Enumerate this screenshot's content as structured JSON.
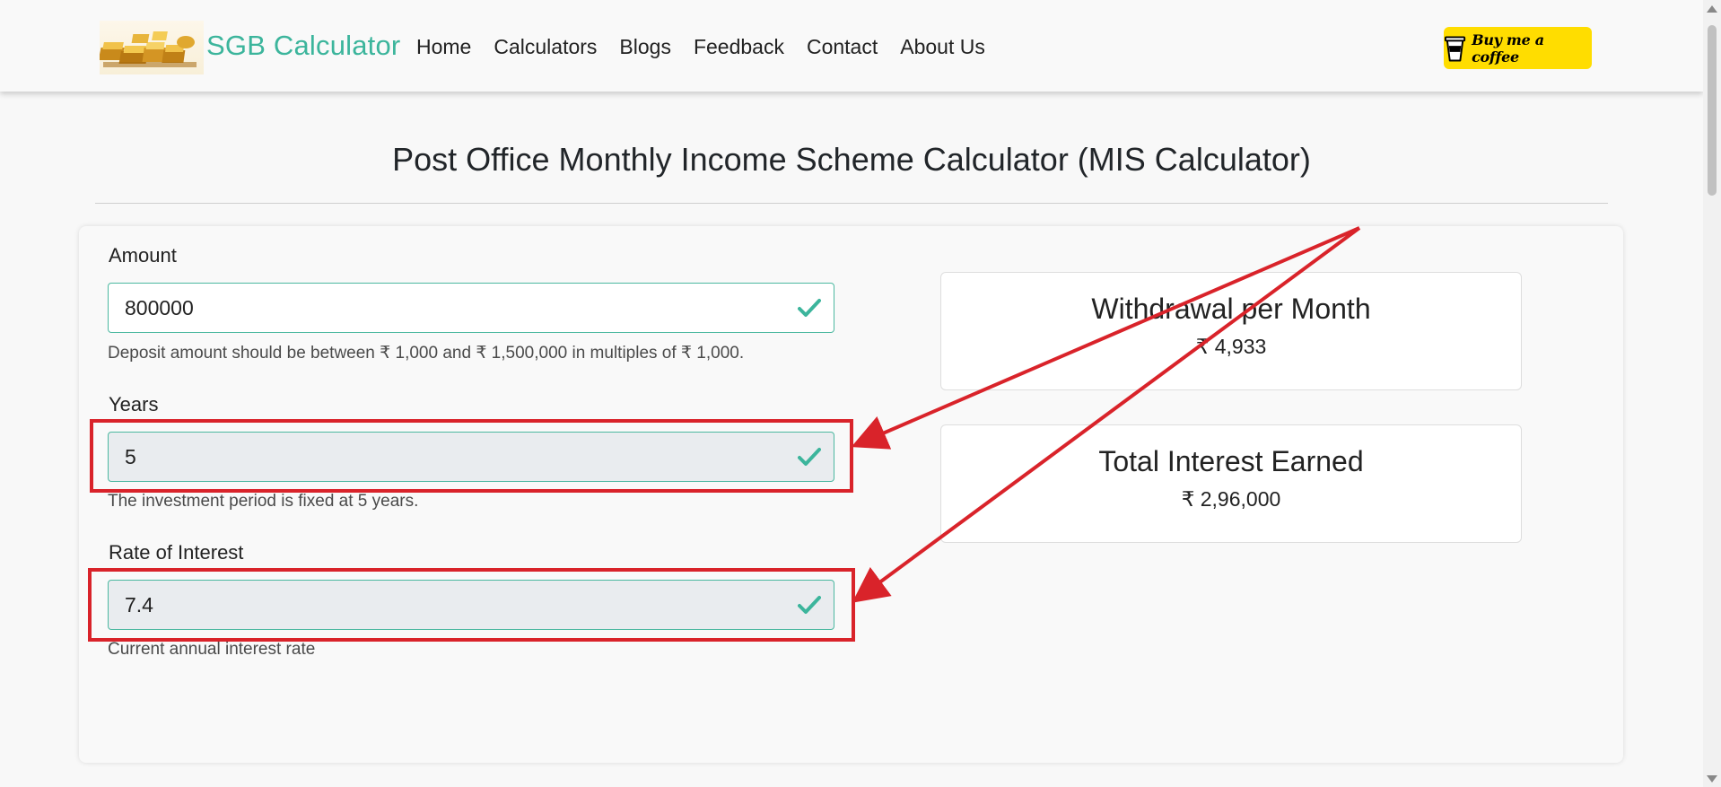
{
  "navbar": {
    "brand_text": "SGB Calculator",
    "nav_items": [
      "Home",
      "Calculators",
      "Blogs",
      "Feedback",
      "Contact",
      "About Us"
    ],
    "coffee_label": "Buy me a coffee",
    "coffee_color": "#ffdd00"
  },
  "page": {
    "title": "Post Office Monthly Income Scheme Calculator (MIS Calculator)"
  },
  "form": {
    "amount": {
      "label": "Amount",
      "value": "800000",
      "help": "Deposit amount should be between ₹ 1,000 and ₹ 1,500,000 in multiples of ₹ 1,000."
    },
    "years": {
      "label": "Years",
      "value": "5",
      "help": "The investment period is fixed at 5 years."
    },
    "rate": {
      "label": "Rate of Interest",
      "value": "7.4",
      "help": "Current annual interest rate"
    }
  },
  "results": {
    "withdrawal": {
      "title": "Withdrawal per Month",
      "value": "₹ 4,933"
    },
    "interest": {
      "title": "Total Interest Earned",
      "value": "₹ 2,96,000"
    }
  },
  "colors": {
    "accent": "#3cb59c",
    "annotation": "#d9232a",
    "input_border": "#4cb8a0"
  },
  "icons": [
    "gold-bars-logo",
    "coffee-cup-icon",
    "check-icon"
  ]
}
